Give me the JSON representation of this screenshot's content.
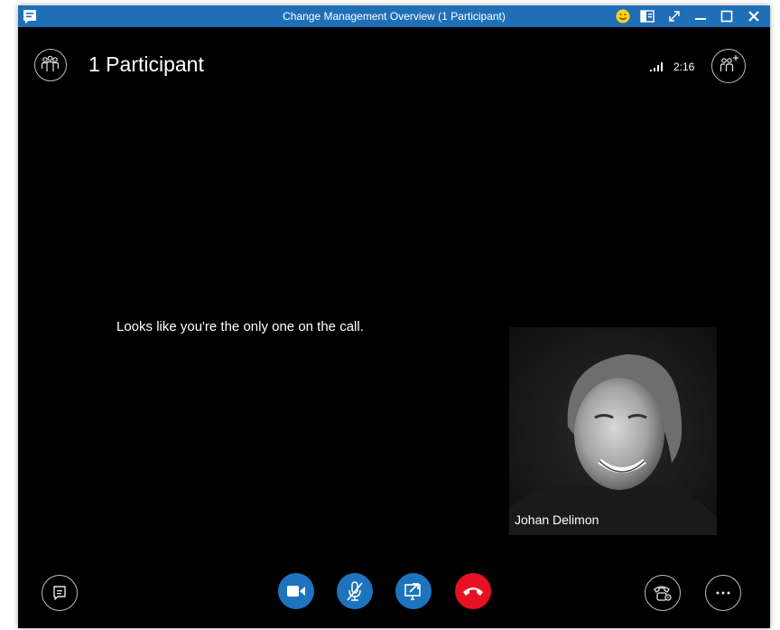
{
  "window": {
    "title": "Change Management Overview (1 Participant)",
    "titlebar_color": "#1f6fb7",
    "controls": [
      "emoji-icon",
      "layout-icon",
      "expand-icon",
      "minimize-icon",
      "maximize-icon",
      "close-icon"
    ]
  },
  "header": {
    "participants_label": "1 Participant",
    "call_timer": "2:16"
  },
  "stage": {
    "message": "Looks like you're the only one on the call.",
    "self_name": "Johan Delimon"
  },
  "controls": {
    "left": [
      "im-icon"
    ],
    "center": [
      "video-camera-icon",
      "mute-microphone-icon",
      "share-screen-icon",
      "hang-up-icon"
    ],
    "right": [
      "call-controls-icon",
      "more-options-icon"
    ],
    "accent_blue": "#1e73be",
    "hangup_red": "#e81123"
  }
}
